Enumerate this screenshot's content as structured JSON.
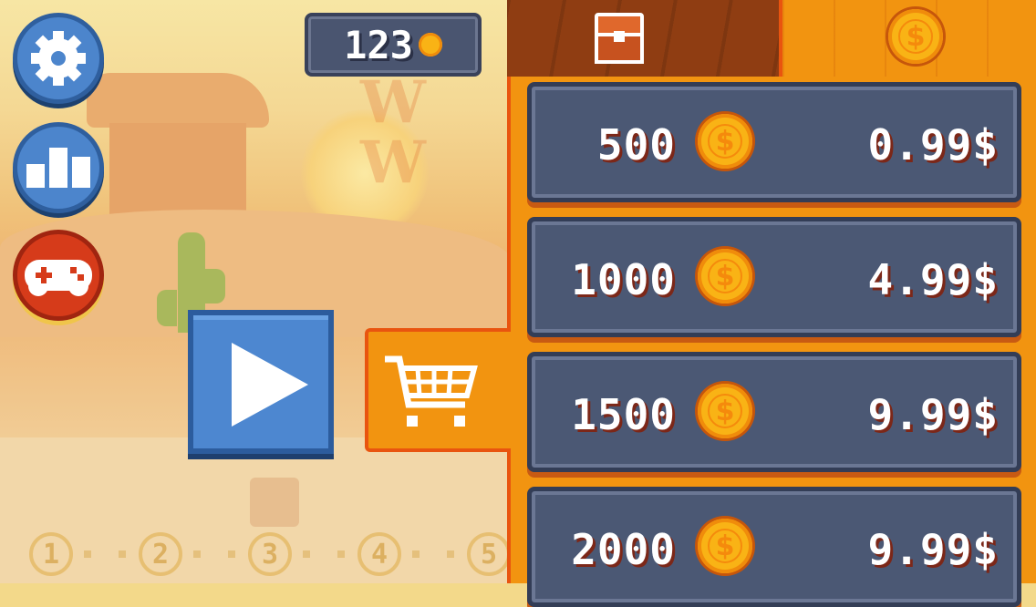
{
  "wallet": {
    "coins": "123"
  },
  "scene": {
    "logo_letters": "W W"
  },
  "level_select": {
    "levels": [
      "1",
      "2",
      "3",
      "4",
      "5"
    ]
  },
  "shop": {
    "offers": [
      {
        "amount": "500",
        "price": "0.99$"
      },
      {
        "amount": "1000",
        "price": "4.99$"
      },
      {
        "amount": "1500",
        "price": "9.99$"
      },
      {
        "amount": "2000",
        "price": "9.99$"
      }
    ]
  },
  "icons": {
    "settings": "gear-icon",
    "leaderboard": "bar-chart-icon",
    "games": "gamepad-icon",
    "play": "play-icon",
    "cart": "shopping-cart-icon",
    "chest_tab": "treasure-chest-icon",
    "coins_tab": "dollar-coin-icon"
  },
  "colors": {
    "shop_orange": "#f29410",
    "button_blue": "#4c85cc",
    "gamepad_red": "#d63b1a",
    "offer_slate": "#4b5874",
    "coin_gold": "#f9b315"
  }
}
